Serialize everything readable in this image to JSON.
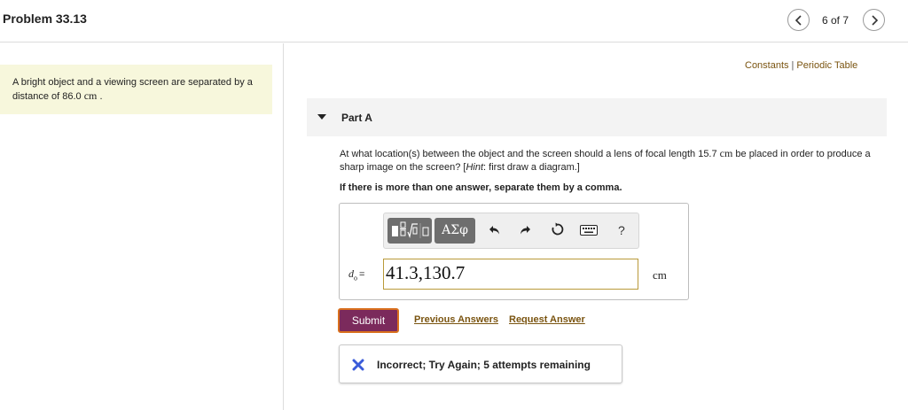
{
  "header": {
    "title": "Problem 33.13",
    "page_count": "6 of 7",
    "prev_icon": "chevron-left-icon",
    "next_icon": "chevron-right-icon"
  },
  "intro": {
    "text_before": "A bright object and a viewing screen are separated by a distance of 86.0 ",
    "unit": "cm",
    "text_after": " ."
  },
  "top_links": {
    "constants": "Constants",
    "separator": "|",
    "periodic_table": "Periodic Table"
  },
  "part": {
    "title": "Part A",
    "caret_icon": "caret-down-icon"
  },
  "question": {
    "text_before": "At what location(s) between the object and the screen should a lens of focal length 15.7 ",
    "unit": "cm",
    "text_mid": " be placed in order to produce a sharp image on the screen? [",
    "hint_label": "Hint",
    "hint_text": ": first draw a diagram.]",
    "instruction": "If there is more than one answer, separate them by a comma."
  },
  "answer": {
    "toolbar": {
      "math_templates_icon": "math-templates-icon",
      "greek_label": "ΑΣφ",
      "undo_icon": "undo-icon",
      "redo_icon": "redo-icon",
      "reset_icon": "reset-icon",
      "keyboard_icon": "keyboard-icon",
      "help_label": "?"
    },
    "variable": "d",
    "variable_sub": "o",
    "equals": "=",
    "value": "41.3,130.7",
    "unit": "cm"
  },
  "actions": {
    "submit": "Submit",
    "previous_answers": "Previous Answers",
    "request_answer": "Request Answer"
  },
  "feedback": {
    "icon": "close-x-icon",
    "text": "Incorrect; Try Again; 5 attempts remaining"
  },
  "colors": {
    "submit_bg": "#7b2a5c",
    "submit_border": "#d9701e",
    "link": "#7a5410",
    "intro_bg": "#f7f7dc",
    "feedback_icon": "#3a5bd9"
  }
}
